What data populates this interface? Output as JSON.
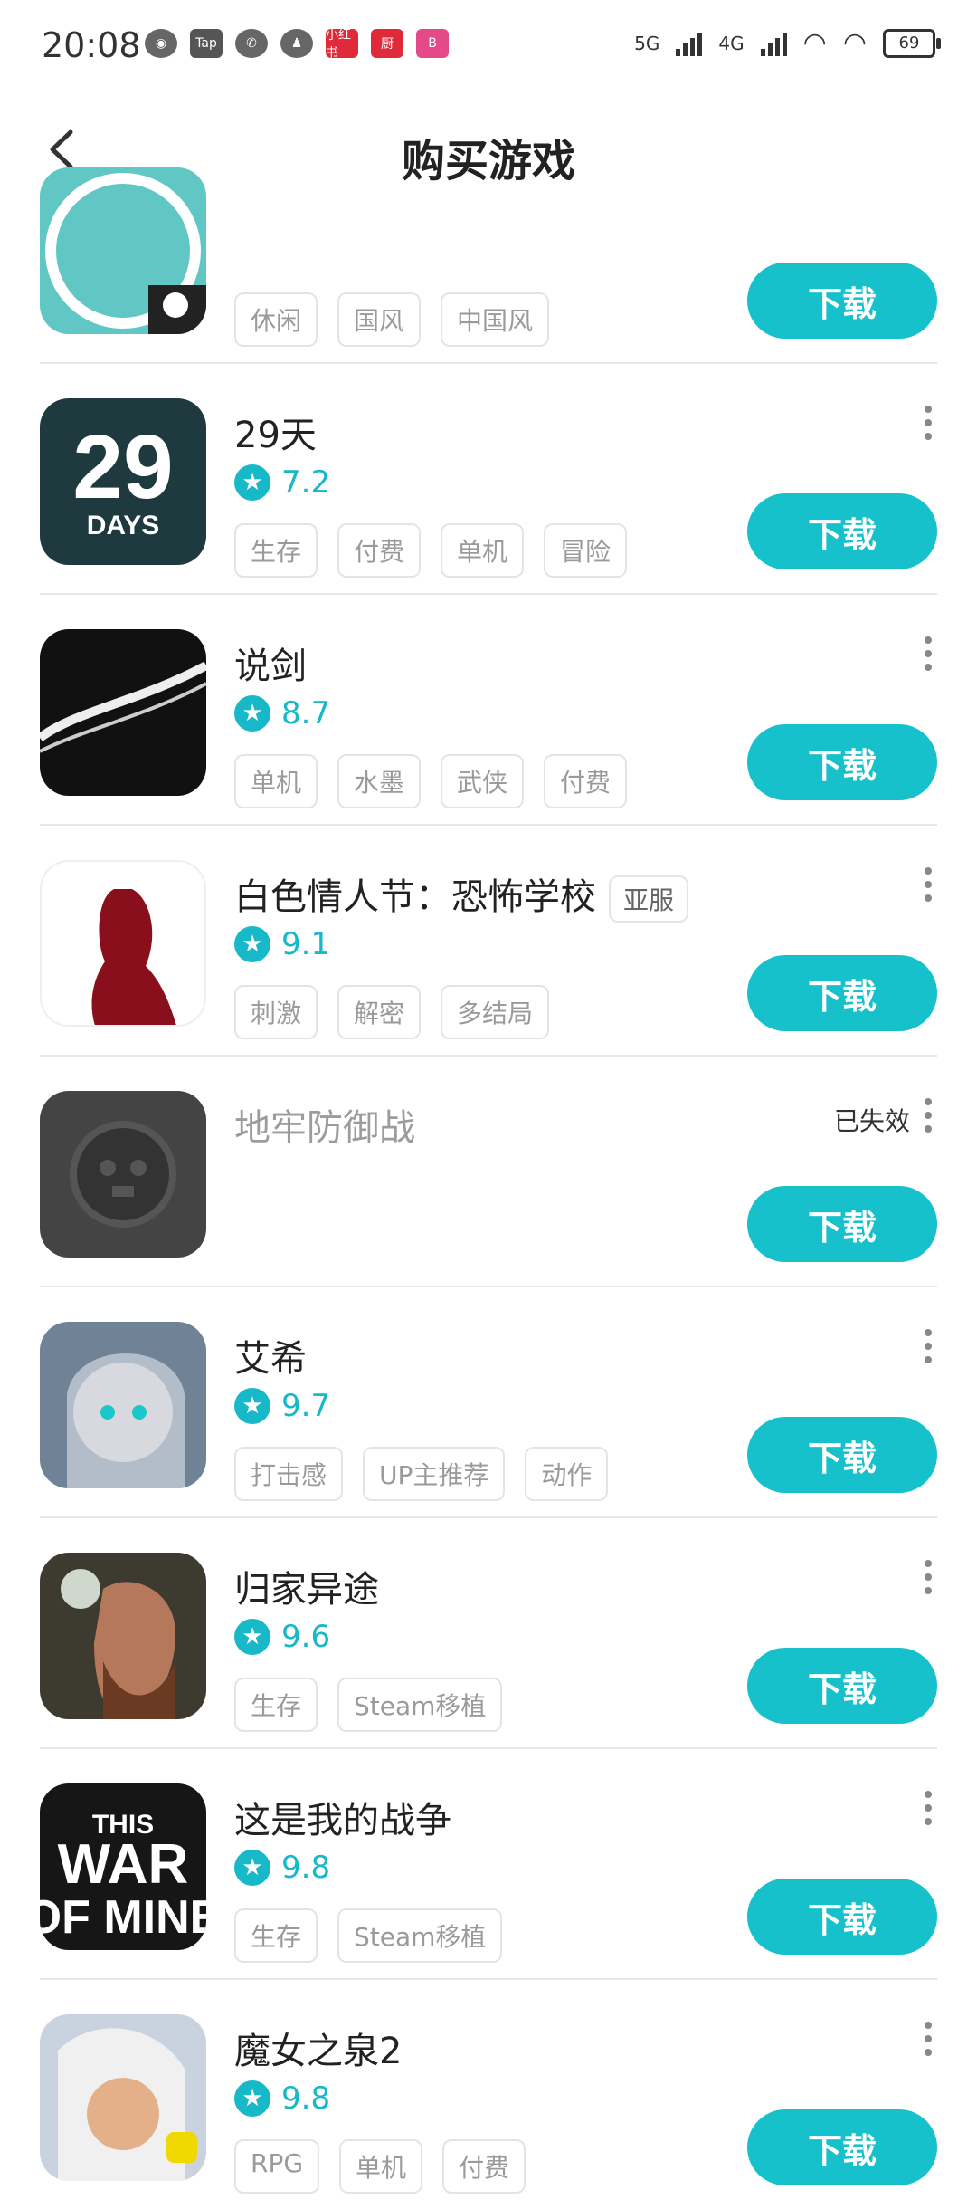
{
  "status_bar": {
    "time": "20:08",
    "app_icons": [
      "bilibili-icon",
      "Tap",
      "wechat-icon",
      "qq-icon",
      "小红书",
      "厨",
      "bilibili"
    ],
    "network": [
      "5G",
      "4G"
    ],
    "battery": "69"
  },
  "header": {
    "title": "购买游戏"
  },
  "colors": {
    "accent": "#16c1cb",
    "rating": "#17b8c8"
  },
  "games": [
    {
      "name": "",
      "rating": "",
      "region": "",
      "expired": "",
      "tags": [
        "休闲",
        "国风",
        "中国风"
      ],
      "button": "下载",
      "icon_color": "#61c7c4"
    },
    {
      "name": "29天",
      "rating": "7.2",
      "region": "",
      "expired": "",
      "tags": [
        "生存",
        "付费",
        "单机",
        "冒险"
      ],
      "button": "下载",
      "icon_color": "#1e3a3f"
    },
    {
      "name": "说剑",
      "rating": "8.7",
      "region": "",
      "expired": "",
      "tags": [
        "单机",
        "水墨",
        "武侠",
        "付费"
      ],
      "button": "下载",
      "icon_color": "#111111"
    },
    {
      "name": "白色情人节：恐怖学校",
      "rating": "9.1",
      "region": "亚服",
      "expired": "",
      "tags": [
        "刺激",
        "解密",
        "多结局"
      ],
      "button": "下载",
      "icon_color": "#ffffff"
    },
    {
      "name": "地牢防御战",
      "rating": "",
      "region": "",
      "expired": "已失效",
      "tags": [],
      "button": "下载",
      "icon_color": "#444444"
    },
    {
      "name": "艾希",
      "rating": "9.7",
      "region": "",
      "expired": "",
      "tags": [
        "打击感",
        "UP主推荐",
        "动作"
      ],
      "button": "下载",
      "icon_color": "#7a8a9c"
    },
    {
      "name": "归家异途",
      "rating": "9.6",
      "region": "",
      "expired": "",
      "tags": [
        "生存",
        "Steam移植"
      ],
      "button": "下载",
      "icon_color": "#5a4a3a"
    },
    {
      "name": "这是我的战争",
      "rating": "9.8",
      "region": "",
      "expired": "",
      "tags": [
        "生存",
        "Steam移植"
      ],
      "button": "下载",
      "icon_color": "#1a1a1a"
    },
    {
      "name": "魔女之泉2",
      "rating": "9.8",
      "region": "",
      "expired": "",
      "tags": [
        "RPG",
        "单机",
        "付费"
      ],
      "button": "下载",
      "icon_color": "#c9d3e0"
    }
  ]
}
